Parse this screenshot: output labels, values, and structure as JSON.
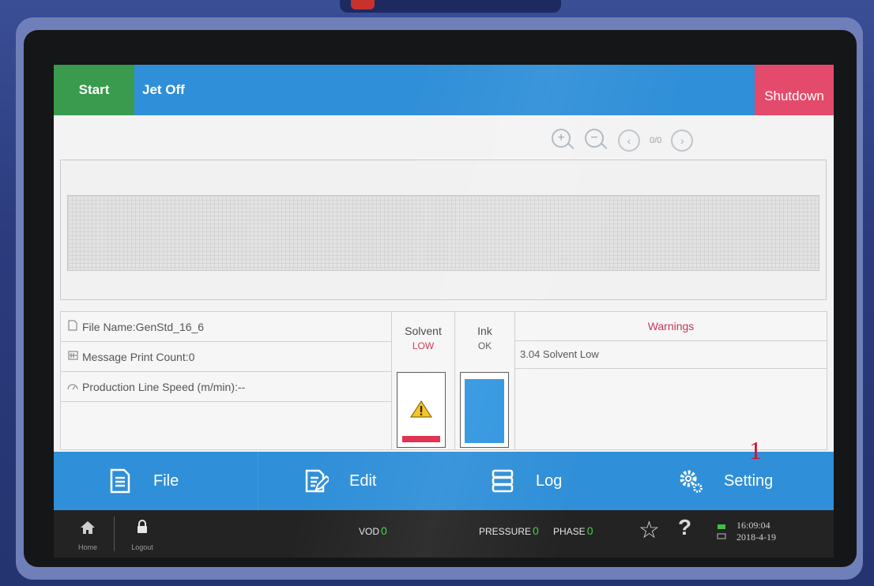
{
  "topbar": {
    "start_label": "Start",
    "jet_status": "Jet Off",
    "shutdown_label": "Shutdown"
  },
  "preview_toolbar": {
    "page_indicator": "0/0"
  },
  "info": {
    "file_name": "File Name:GenStd_16_6",
    "print_count": "Message Print Count:0",
    "line_speed": "Production Line Speed (m/min):--"
  },
  "solvent": {
    "title": "Solvent",
    "state": "LOW",
    "state_color": "#d6334f"
  },
  "ink": {
    "title": "Ink",
    "state": "OK",
    "level": 0.96,
    "fill_color": "#3196e0"
  },
  "warnings": {
    "title": "Warnings",
    "items": [
      "3.04 Solvent Low"
    ]
  },
  "nav": {
    "file_label": "File",
    "edit_label": "Edit",
    "log_label": "Log",
    "setting_label": "Setting"
  },
  "annotation": {
    "marker": "1"
  },
  "status": {
    "home_label": "Home",
    "logout_label": "Logout",
    "vod_label": "VOD",
    "vod_value": "0",
    "pressure_label": "PRESSURE",
    "pressure_value": "0",
    "phase_label": "PHASE",
    "phase_value": "0",
    "time": "16:09:04",
    "date": "2018-4-19"
  },
  "colors": {
    "bar_blue": "#2f8fd8",
    "start_green": "#3a9a4d",
    "shutdown_pink": "#e44a6b"
  }
}
